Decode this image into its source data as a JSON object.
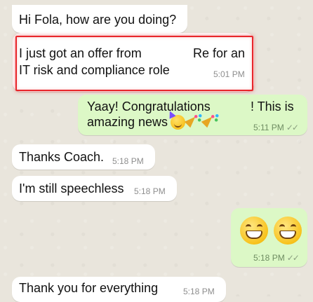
{
  "messages": [
    {
      "direction": "incoming",
      "text": "Hi Fola, how are you doing?",
      "time": ""
    },
    {
      "direction": "incoming",
      "line1a": "I just got an offer from",
      "line1b": "Re for an",
      "line2": "IT risk and compliance role",
      "time": "5:01 PM",
      "highlighted": true
    },
    {
      "direction": "outgoing",
      "line1a": "Yaay! Congratulations",
      "line1b": "! This is",
      "line2": "amazing news",
      "emojis": [
        "partying-face-icon",
        "party-popper-icon",
        "party-popper-icon"
      ],
      "time": "5:11 PM",
      "status": "read"
    },
    {
      "direction": "incoming",
      "text": "Thanks Coach.",
      "time": "5:18 PM"
    },
    {
      "direction": "incoming",
      "text": "I'm still speechless",
      "time": "5:18 PM"
    },
    {
      "direction": "outgoing",
      "emojis": [
        "grinning-face-icon",
        "grinning-face-icon"
      ],
      "time": "5:18 PM",
      "status": "read"
    },
    {
      "direction": "incoming",
      "text": "Thank you for everything",
      "time": "5:18 PM"
    }
  ],
  "colors": {
    "background": "#e9e5dc",
    "incoming_bubble": "#ffffff",
    "outgoing_bubble": "#dcf8c6",
    "highlight": "#e8262b"
  },
  "ticks": "✓✓"
}
